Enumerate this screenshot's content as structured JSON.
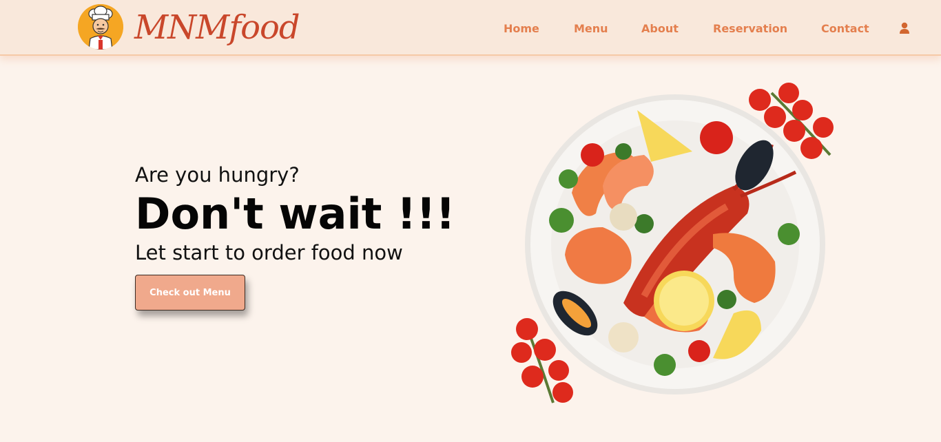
{
  "brand": {
    "name": "MNMfood",
    "logo_icon": "chef-icon"
  },
  "nav": {
    "items": [
      {
        "label": "Home"
      },
      {
        "label": "Menu"
      },
      {
        "label": "About"
      },
      {
        "label": "Reservation"
      },
      {
        "label": "Contact"
      }
    ],
    "user_icon": "user-icon"
  },
  "hero": {
    "question": "Are you hungry?",
    "headline": "Don't wait !!!",
    "subtitle": "Let start to order food now",
    "cta_label": "Check out Menu",
    "image_icon": "seafood-plate"
  },
  "colors": {
    "page_bg": "#fcf3ec",
    "nav_bg": "#f9e8db",
    "brand": "#c9472b",
    "nav_link": "#e47f4e",
    "cta_bg": "#f0a98c"
  }
}
